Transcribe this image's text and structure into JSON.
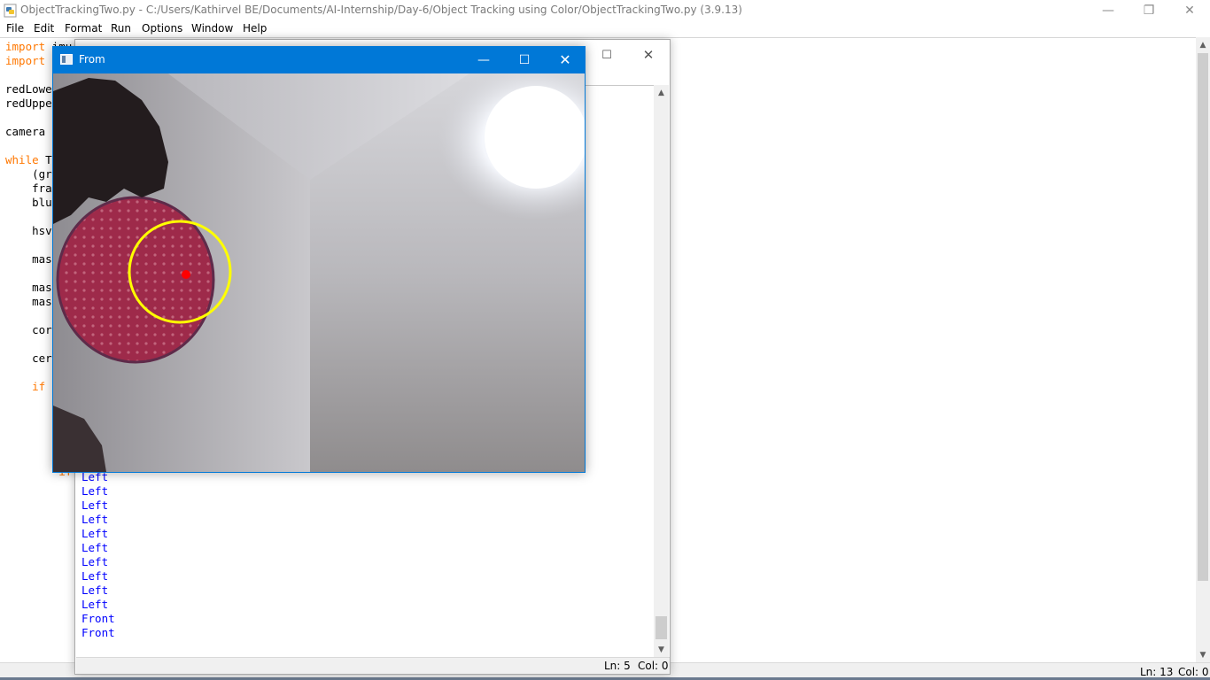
{
  "editor": {
    "title": "ObjectTrackingTwo.py - C:/Users/Kathirvel BE/Documents/AI-Internship/Day-6/Object Tracking using Color/ObjectTrackingTwo.py (3.9.13)",
    "window_controls": {
      "minimize": "—",
      "maximize": "❐",
      "close": "✕"
    },
    "menu": [
      "File",
      "Edit",
      "Format",
      "Run",
      "Options",
      "Window",
      "Help"
    ],
    "code_lines": [
      {
        "kw": "import",
        "rest": " imu"
      },
      {
        "kw": "import",
        "rest": ""
      },
      {
        "kw": "",
        "rest": "redLowe"
      },
      {
        "kw": "",
        "rest": "redUppe"
      },
      {
        "kw": "",
        "rest": "camera "
      },
      {
        "kw": "while",
        "rest": " T"
      },
      {
        "kw": "",
        "rest": "    (gr"
      },
      {
        "kw": "",
        "rest": "    fra"
      },
      {
        "kw": "",
        "rest": "    blu"
      },
      {
        "kw": "",
        "rest": "    hsv"
      },
      {
        "kw": "",
        "rest": "    mas"
      },
      {
        "kw": "",
        "rest": "    mas"
      },
      {
        "kw": "",
        "rest": "    mas"
      },
      {
        "kw": "",
        "rest": "    cor"
      },
      {
        "kw": "",
        "rest": "    cer"
      },
      {
        "kw": "    if",
        "rest": ""
      },
      {
        "kw": "        if",
        "rest": ""
      }
    ],
    "scroll_up": "▲",
    "scroll_down": "▼",
    "status": {
      "ln": "Ln: 13",
      "col": "Col: 0"
    }
  },
  "shell": {
    "window_controls": {
      "maximize": "☐",
      "close": "✕"
    },
    "output_lines": [
      "Left",
      "Left",
      "Left",
      "Left",
      "Left",
      "Left",
      "Left",
      "Left",
      "Left",
      "Left",
      "Front",
      "Front"
    ],
    "scroll_up": "▲",
    "scroll_down": "▼",
    "status": {
      "ln": "Ln: 5",
      "col": "Col: 0"
    }
  },
  "from_window": {
    "title": "From",
    "window_controls": {
      "minimize": "—",
      "maximize": "☐",
      "close": "✕"
    },
    "overlay_colors": {
      "tracking_circle": "#ffff00",
      "centroid": "#ff0000"
    }
  },
  "colors": {
    "keyword": "#ff7700",
    "shell_output": "#0000ff",
    "accent": "#0078d7"
  }
}
